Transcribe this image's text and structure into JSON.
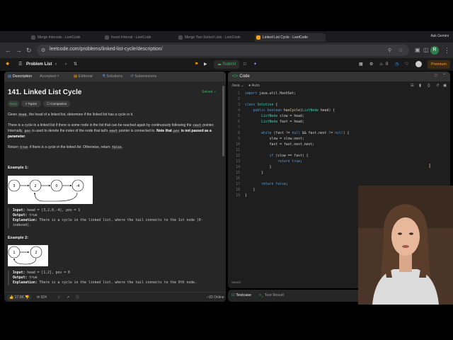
{
  "browser": {
    "tabs": [
      {
        "label": "Merge Intervals - LeetCode"
      },
      {
        "label": "Insert Interval - LeetCode"
      },
      {
        "label": "Merge Two Sorted Lists - LeetCode"
      },
      {
        "label": "Linked List Cycle - LeetCode"
      }
    ],
    "profile_label": "Ask Gemini",
    "url": "leetcode.com/problems/linked-list-cycle/description/",
    "avatar_letter": "R"
  },
  "header": {
    "problem_list_label": "Problem List",
    "submit_label": "Submit",
    "streak_count": "0",
    "premium_label": "Premium"
  },
  "left_tabs": [
    {
      "label": "Description"
    },
    {
      "label": "Accepted"
    },
    {
      "label": "Editorial"
    },
    {
      "label": "Solutions"
    },
    {
      "label": "Submissions"
    }
  ],
  "problem": {
    "title": "141. Linked List Cycle",
    "status": "Solved",
    "difficulty": "Easy",
    "topics_label": "Topics",
    "companies_label": "Companies",
    "p1_a": "Given ",
    "p1_code": "head",
    "p1_b": ", the head of a linked list, determine if the linked list has a cycle in it.",
    "p2_a": "There is a cycle in a linked list if there is some node in the list that can be reached again by continuously following the ",
    "p2_code1": "next",
    "p2_b": " pointer. Internally, ",
    "p2_code2": "pos",
    "p2_c": " is used to denote the index of the node that tail's ",
    "p2_code3": "next",
    "p2_d": " pointer is connected to. ",
    "p2_bold": "Note that ",
    "p2_code4": "pos",
    "p2_bold2": " is not passed as a parameter",
    "p2_end": ".",
    "p3_a": "Return ",
    "p3_code1": "true",
    "p3_b": " if there is a cycle in the linked list",
    "p3_c": ". Otherwise, return ",
    "p3_code2": "false",
    "p3_d": "."
  },
  "examples": [
    {
      "title": "Example 1:",
      "nodes": [
        "3",
        "2",
        "0",
        "-4"
      ],
      "input_label": "Input:",
      "input": "head = [3,2,0,-4], pos = 1",
      "output_label": "Output:",
      "output": "true",
      "explanation_label": "Explanation:",
      "explanation": "There is a cycle in the linked list, where the tail connects to the 1st node (0-indexed)."
    },
    {
      "title": "Example 2:",
      "nodes": [
        "1",
        "2"
      ],
      "input_label": "Input:",
      "input": "head = [1,2], pos = 0",
      "output_label": "Output:",
      "output": "true",
      "explanation_label": "Explanation:",
      "explanation": "There is a cycle in the linked list, where the tail connects to the 0th node."
    }
  ],
  "left_footer": {
    "likes": "17.6K",
    "comments": "924",
    "online": "83 Online"
  },
  "editor": {
    "tab_label": "Code",
    "language": "Java",
    "auto_label": "Auto",
    "saved_label": "Saved",
    "lines": [
      {
        "n": "1",
        "text": "import java.util.HashSet;"
      },
      {
        "n": "2",
        "text": ""
      },
      {
        "n": "3",
        "text": "class Solution {"
      },
      {
        "n": "4",
        "text": "    public boolean hasCycle(ListNode head) {"
      },
      {
        "n": "5",
        "text": "        ListNode slow = head;"
      },
      {
        "n": "6",
        "text": "        ListNode fast = head;"
      },
      {
        "n": "7",
        "text": ""
      },
      {
        "n": "8",
        "text": "        while (fast != null && fast.next != null) {"
      },
      {
        "n": "9",
        "text": "            slow = slow.next;"
      },
      {
        "n": "10",
        "text": "            fast = fast.next.next;"
      },
      {
        "n": "11",
        "text": ""
      },
      {
        "n": "12",
        "text": "            if (slow == fast) {"
      },
      {
        "n": "13",
        "text": "                return true;"
      },
      {
        "n": "14",
        "text": "            }"
      },
      {
        "n": "15",
        "text": "        }"
      },
      {
        "n": "16",
        "text": ""
      },
      {
        "n": "17",
        "text": "        return false;"
      },
      {
        "n": "18",
        "text": "    }"
      },
      {
        "n": "19",
        "text": "}"
      }
    ]
  },
  "bottom_tabs": [
    {
      "label": "Testcase"
    },
    {
      "label": "Test Result"
    }
  ],
  "colors": {
    "accent_orange": "#ffa116",
    "green": "#2cbb5d",
    "panel_bg": "#262626",
    "editor_bg": "#1e1e1e"
  }
}
